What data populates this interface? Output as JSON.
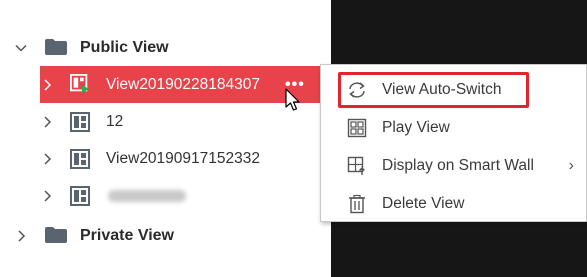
{
  "tree": {
    "public_view": {
      "label": "Public View"
    },
    "items": [
      {
        "label": "View20190228184307",
        "selected": true,
        "more": "•••"
      },
      {
        "label": "12"
      },
      {
        "label": "View20190917152332"
      },
      {
        "label": ""
      }
    ],
    "private_view": {
      "label": "Private View"
    }
  },
  "context_menu": {
    "items": [
      {
        "label": "View Auto-Switch",
        "icon": "auto-switch-icon",
        "highlighted": true
      },
      {
        "label": "Play View",
        "icon": "play-view-icon"
      },
      {
        "label": "Display on Smart Wall",
        "icon": "smart-wall-icon",
        "submenu": "›"
      },
      {
        "label": "Delete View",
        "icon": "trash-icon"
      }
    ]
  },
  "colors": {
    "selected_bg": "#e8424b",
    "highlight_border": "#e0262c",
    "dark_panel": "#161616"
  }
}
